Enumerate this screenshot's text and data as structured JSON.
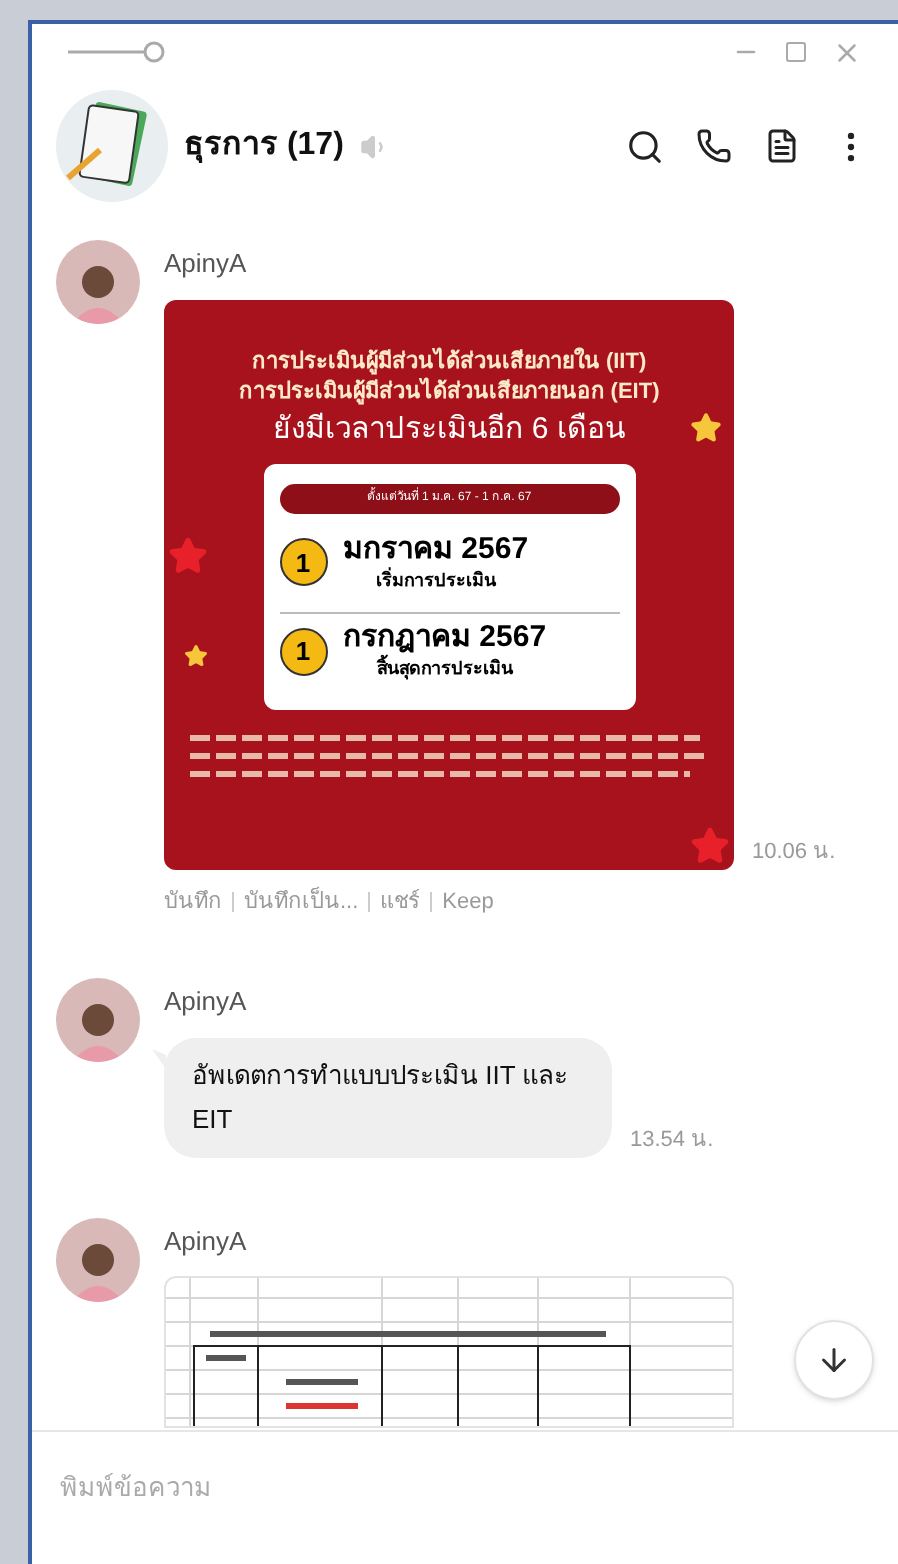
{
  "chat": {
    "name": "ธุรการ (17)",
    "muted": true
  },
  "messages": [
    {
      "kind": "poster",
      "sender": "ApinyA",
      "time": "10.06 น.",
      "poster": {
        "title_lines": [
          "การประเมินผู้มีส่วนได้ส่วนเสียภายใน (IIT)",
          "การประเมินผู้มีส่วนได้ส่วนเสียภายนอก (EIT)"
        ],
        "subtitle": "ยังมีเวลาประเมินอีก 6 เดือน",
        "period": "ตั้งแต่วันที่ 1 ม.ค. 67 - 1 ก.ค. 67",
        "steps": [
          {
            "number": "1",
            "month": "มกราคม 2567",
            "label": "เริ่มการประเมิน"
          },
          {
            "number": "1",
            "month": "กรกฎาคม 2567",
            "label": "สิ้นสุดการประเมิน"
          }
        ]
      },
      "actions": [
        "บันทึก",
        "บันทึกเป็น...",
        "แชร์",
        "Keep"
      ]
    },
    {
      "kind": "text",
      "sender": "ApinyA",
      "time": "13.54 น.",
      "text": "อัพเดตการทำแบบประเมิน IIT และ EIT"
    },
    {
      "kind": "spreadsheet",
      "sender": "ApinyA"
    }
  ],
  "input": {
    "placeholder": "พิมพ์ข้อความ"
  }
}
